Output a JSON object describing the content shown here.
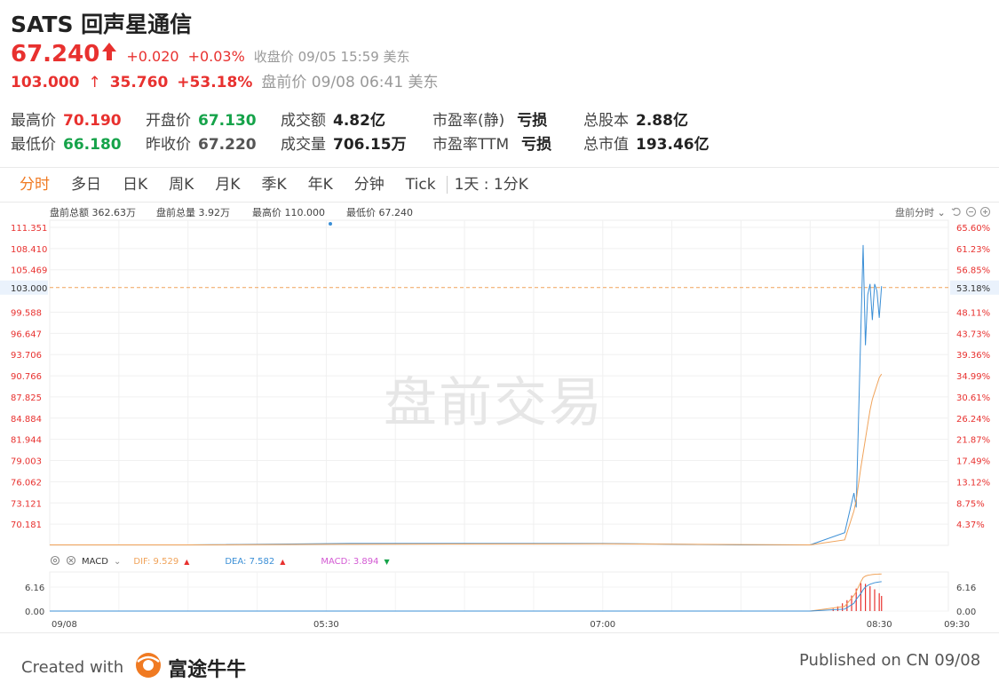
{
  "header": {
    "title": "SATS 回声星通信",
    "price": "67.240",
    "change": "+0.020",
    "change_pct": "+0.03%",
    "close_label": "收盘价 09/05 15:59 美东",
    "pre_price": "103.000",
    "pre_arrow": "↑",
    "pre_change": "35.760",
    "pre_change_pct": "+53.18%",
    "pre_label": "盘前价 09/08 06:41 美东"
  },
  "stats": {
    "high_label": "最高价",
    "high": "70.190",
    "open_label": "开盘价",
    "open": "67.130",
    "amount_label": "成交额",
    "amount": "4.82亿",
    "pe_static_label": "市盈率(静)",
    "pe_static": "亏损",
    "shares_label": "总股本",
    "shares": "2.88亿",
    "low_label": "最低价",
    "low": "66.180",
    "prev_label": "昨收价",
    "prev": "67.220",
    "volume_label": "成交量",
    "volume": "706.15万",
    "pe_ttm_label": "市盈率TTM",
    "pe_ttm": "亏损",
    "mcap_label": "总市值",
    "mcap": "193.46亿"
  },
  "tabs": [
    "分时",
    "多日",
    "日K",
    "周K",
    "月K",
    "季K",
    "年K",
    "分钟",
    "Tick",
    "1天 : 1分K"
  ],
  "chart_info": {
    "pre_amount": "盘前总额 362.63万",
    "pre_volume": "盘前总量 3.92万",
    "max_price": "最高价 110.000",
    "min_price": "最低价 67.240",
    "mode_label": "盘前分时 ⌄",
    "watermark": "盘前交易"
  },
  "macd": {
    "label": "MACD",
    "dif": "DIF: 9.529",
    "dea": "DEA: 7.582",
    "macd": "MACD: 3.894",
    "ticks": [
      "6.16",
      "0.00"
    ]
  },
  "footer": {
    "created": "Created with",
    "brand": "富途牛牛",
    "published": "Published on CN 09/08"
  },
  "colors": {
    "up": "#e8312f",
    "down": "#16a34a",
    "price_line": "#3b8fd6",
    "avg_line": "#f0a35a",
    "accent": "#f07a22"
  },
  "chart_data": {
    "type": "line",
    "title": "",
    "xlabel": "",
    "ylabel": "",
    "x_ticks": [
      "09/08",
      "05:30",
      "07:00",
      "08:30",
      "09:30"
    ],
    "y_ticks_left": [
      "111.351",
      "108.410",
      "105.469",
      "103.000",
      "99.588",
      "96.647",
      "93.706",
      "90.766",
      "87.825",
      "84.884",
      "81.944",
      "79.003",
      "76.062",
      "73.121",
      "70.181"
    ],
    "y_ticks_right": [
      "65.60%",
      "61.23%",
      "56.85%",
      "53.18%",
      "48.11%",
      "43.73%",
      "39.36%",
      "34.99%",
      "30.61%",
      "26.24%",
      "21.87%",
      "17.49%",
      "13.12%",
      "8.75%",
      "4.37%"
    ],
    "ylim": [
      67.24,
      111.351
    ],
    "current_price": 103.0,
    "x_minutes": [
      0,
      60,
      130,
      240,
      300,
      330,
      345,
      349,
      350,
      352,
      353,
      354,
      355,
      356,
      357,
      358,
      359,
      360,
      361
    ],
    "series": [
      {
        "values": [
          67.3,
          67.3,
          67.5,
          67.5,
          67.3,
          67.3,
          69.0,
          74.5,
          72.5,
          97.0,
          108.9,
          95.0,
          102.0,
          103.5,
          98.5,
          103.5,
          102.5,
          98.8,
          103.2
        ]
      },
      {
        "values": [
          67.3,
          67.3,
          67.4,
          67.45,
          67.35,
          67.3,
          68.0,
          72.0,
          73.5,
          78.0,
          80.0,
          82.0,
          84.0,
          86.0,
          87.5,
          88.5,
          89.5,
          90.5,
          91.0
        ]
      }
    ],
    "macd": {
      "dif": [
        0,
        0,
        0,
        0,
        0,
        0,
        1.2,
        4.0,
        5.0,
        7.5,
        8.6,
        9.0,
        9.2,
        9.3,
        9.4,
        9.45,
        9.5,
        9.52,
        9.529
      ],
      "dea": [
        0,
        0,
        0,
        0,
        0,
        0,
        0.5,
        2.0,
        3.0,
        4.5,
        5.5,
        6.2,
        6.6,
        6.9,
        7.1,
        7.3,
        7.4,
        7.5,
        7.582
      ],
      "hist_x": [
        340,
        342,
        344,
        346,
        348,
        350,
        352,
        354,
        356,
        358,
        360,
        361
      ],
      "hist": [
        0.6,
        1.2,
        2.0,
        2.8,
        4.0,
        5.8,
        7.2,
        7.0,
        6.4,
        5.6,
        4.6,
        3.894
      ]
    },
    "grid": true
  }
}
